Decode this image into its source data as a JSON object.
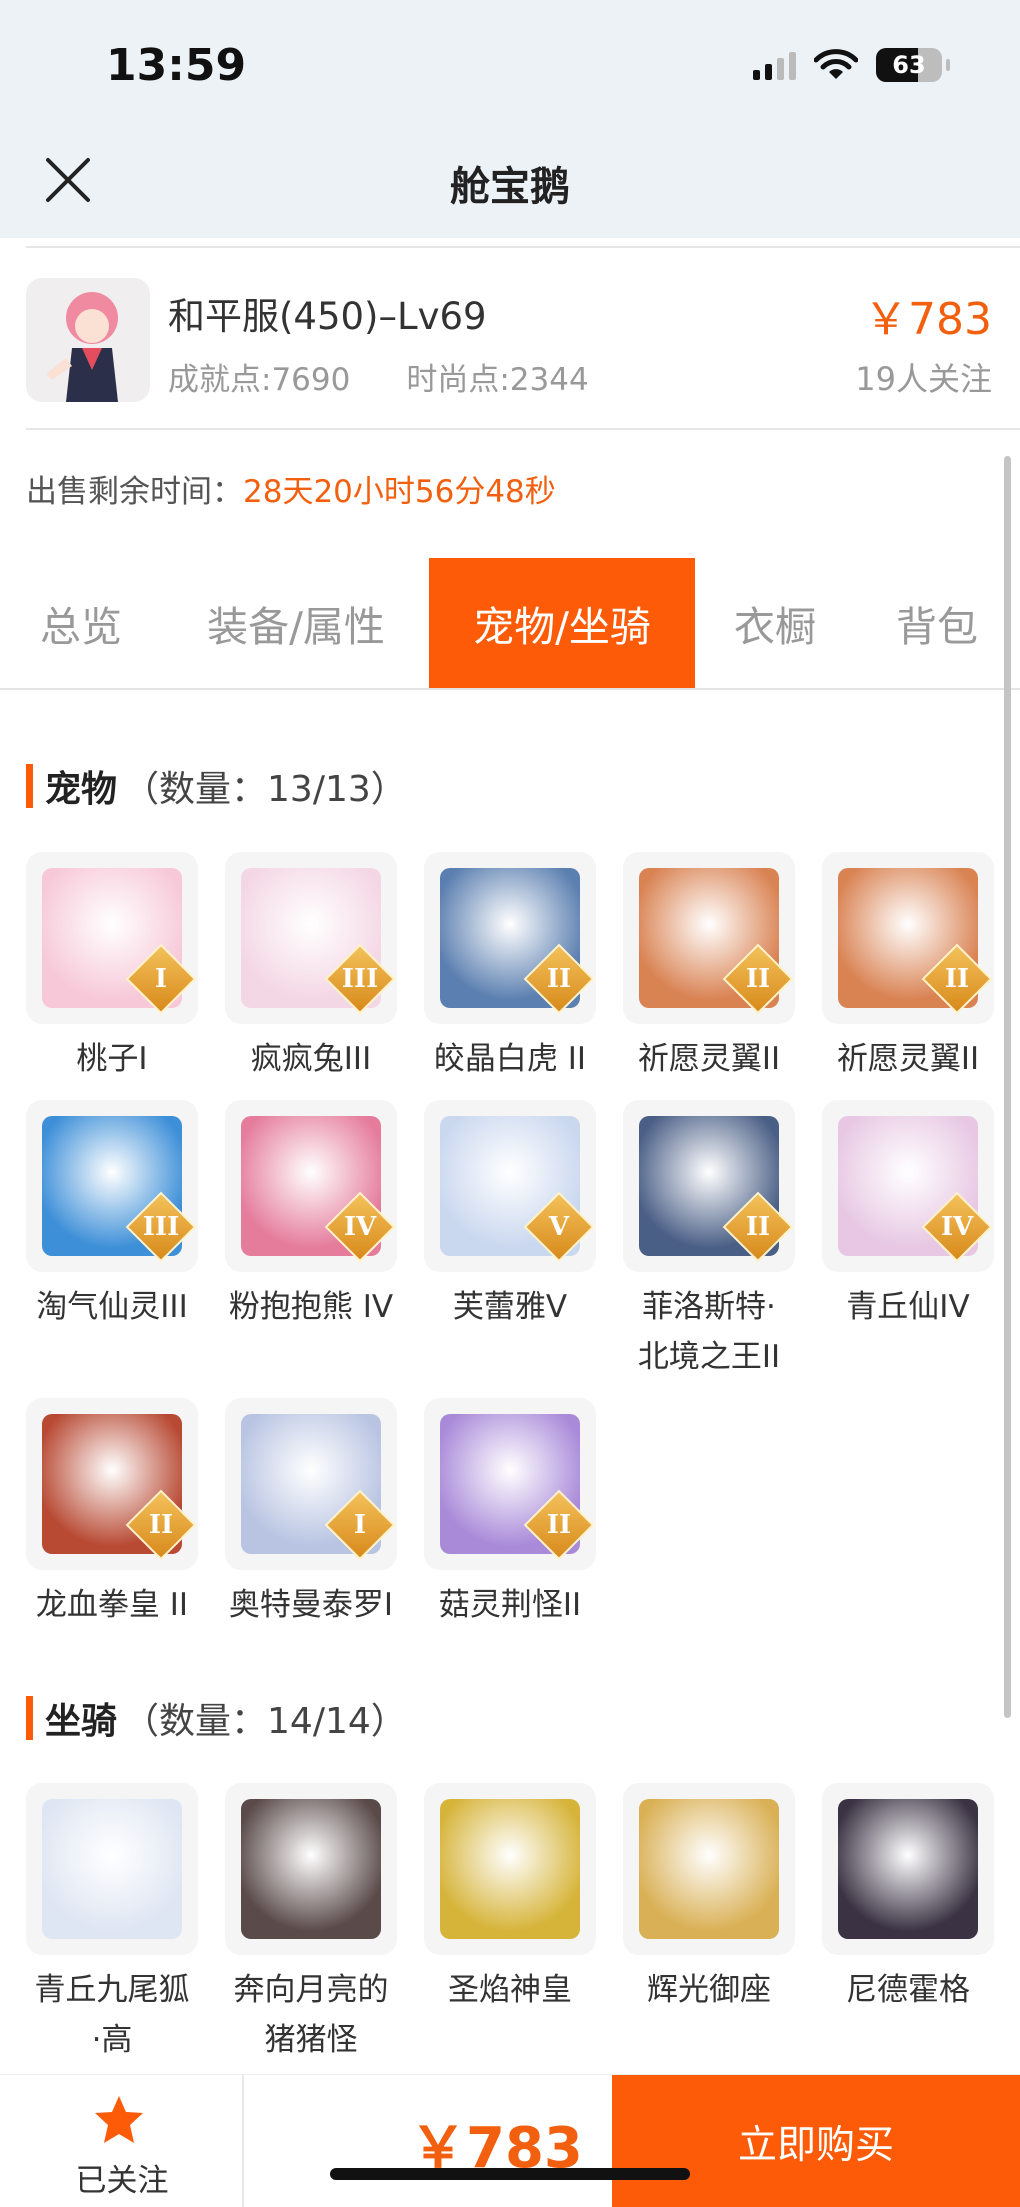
{
  "status_bar": {
    "time": "13:59",
    "battery": "63"
  },
  "header": {
    "title": "舱宝鹅"
  },
  "listing": {
    "server_title": "和平服(450)–Lv69",
    "achievement": "成就点:7690",
    "fashion": "时尚点:2344",
    "price": "￥783",
    "followers": "19人关注",
    "remain_label": "出售剩余时间：",
    "remain_value": "28天20小时56分48秒"
  },
  "tabs": [
    {
      "label": "总览"
    },
    {
      "label": "装备/属性"
    },
    {
      "label": "宠物/坐骑",
      "active": true
    },
    {
      "label": "衣橱"
    },
    {
      "label": "背包"
    }
  ],
  "pets": {
    "title": "宠物",
    "count": "（数量：13/13）",
    "items": [
      {
        "name": "桃子I",
        "rank": "I",
        "color": "#f7c9d8"
      },
      {
        "name": "疯疯兔III",
        "rank": "III",
        "color": "#f4d7e4"
      },
      {
        "name": "皎晶白虎 II",
        "rank": "II",
        "color": "#5b7fb0"
      },
      {
        "name": "祈愿灵翼II",
        "rank": "II",
        "color": "#d98252"
      },
      {
        "name": "祈愿灵翼II",
        "rank": "II",
        "color": "#d98252"
      },
      {
        "name": "淘气仙灵III",
        "rank": "III",
        "color": "#3d8fd8"
      },
      {
        "name": "粉抱抱熊 IV",
        "rank": "IV",
        "color": "#e57c9c"
      },
      {
        "name": "芙蕾雅V",
        "rank": "V",
        "color": "#c9d7ef"
      },
      {
        "name": "菲洛斯特·\n北境之王II",
        "rank": "II",
        "color": "#4a5f86"
      },
      {
        "name": "青丘仙IV",
        "rank": "IV",
        "color": "#e7c7e3"
      },
      {
        "name": "龙血拳皇 II",
        "rank": "II",
        "color": "#b84a34"
      },
      {
        "name": "奥特曼泰罗I",
        "rank": "I",
        "color": "#b8c4e2"
      },
      {
        "name": "菇灵荆怪II",
        "rank": "II",
        "color": "#a98ad9"
      }
    ]
  },
  "mounts": {
    "title": "坐骑",
    "count": "（数量：14/14）",
    "items": [
      {
        "name": "青丘九尾狐\n·高",
        "color": "#dfe6f3"
      },
      {
        "name": "奔向月亮的\n猪猪怪",
        "color": "#5a4a4a"
      },
      {
        "name": "圣焰神皇",
        "color": "#d6b43a"
      },
      {
        "name": "辉光御座",
        "color": "#d9b055"
      },
      {
        "name": "尼德霍格",
        "color": "#3b3344"
      }
    ]
  },
  "bottom_bar": {
    "follow_label": "已关注",
    "price": "￥783",
    "buy_label": "立即购买"
  }
}
